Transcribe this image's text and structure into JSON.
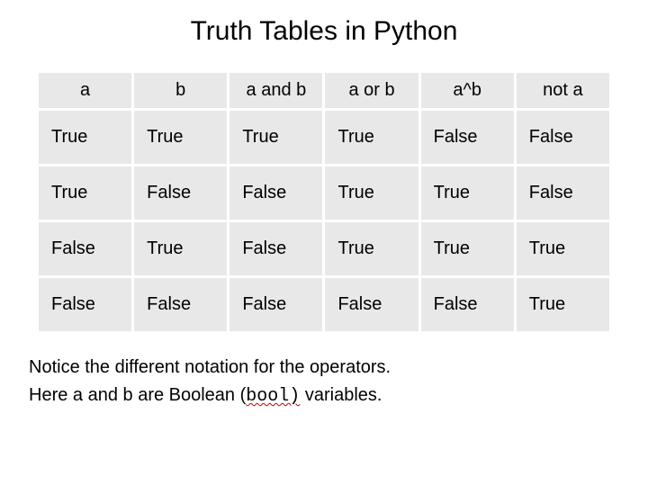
{
  "title": "Truth Tables in Python",
  "table": {
    "headers": [
      "a",
      "b",
      "a and b",
      "a or b",
      "a^b",
      "not a"
    ],
    "rows": [
      [
        "True",
        "True",
        "True",
        "True",
        "False",
        "False"
      ],
      [
        "True",
        "False",
        "False",
        "True",
        "True",
        "False"
      ],
      [
        "False",
        "True",
        "False",
        "True",
        "True",
        "True"
      ],
      [
        "False",
        "False",
        "False",
        "False",
        "False",
        "True"
      ]
    ]
  },
  "chart_data": {
    "type": "table",
    "title": "Truth Tables in Python",
    "columns": [
      "a",
      "b",
      "a and b",
      "a or b",
      "a^b",
      "not a"
    ],
    "data": [
      {
        "a": "True",
        "b": "True",
        "a and b": "True",
        "a or b": "True",
        "a^b": "False",
        "not a": "False"
      },
      {
        "a": "True",
        "b": "False",
        "a and b": "False",
        "a or b": "True",
        "a^b": "True",
        "not a": "False"
      },
      {
        "a": "False",
        "b": "True",
        "a and b": "False",
        "a or b": "True",
        "a^b": "True",
        "not a": "True"
      },
      {
        "a": "False",
        "b": "False",
        "a and b": "False",
        "a or b": "False",
        "a^b": "False",
        "not a": "True"
      }
    ]
  },
  "caption": {
    "line1": "Notice the different notation for the operators.",
    "line2_pre": "Here a and b are Boolean (",
    "line2_code": "bool)",
    "line2_post": " variables."
  }
}
